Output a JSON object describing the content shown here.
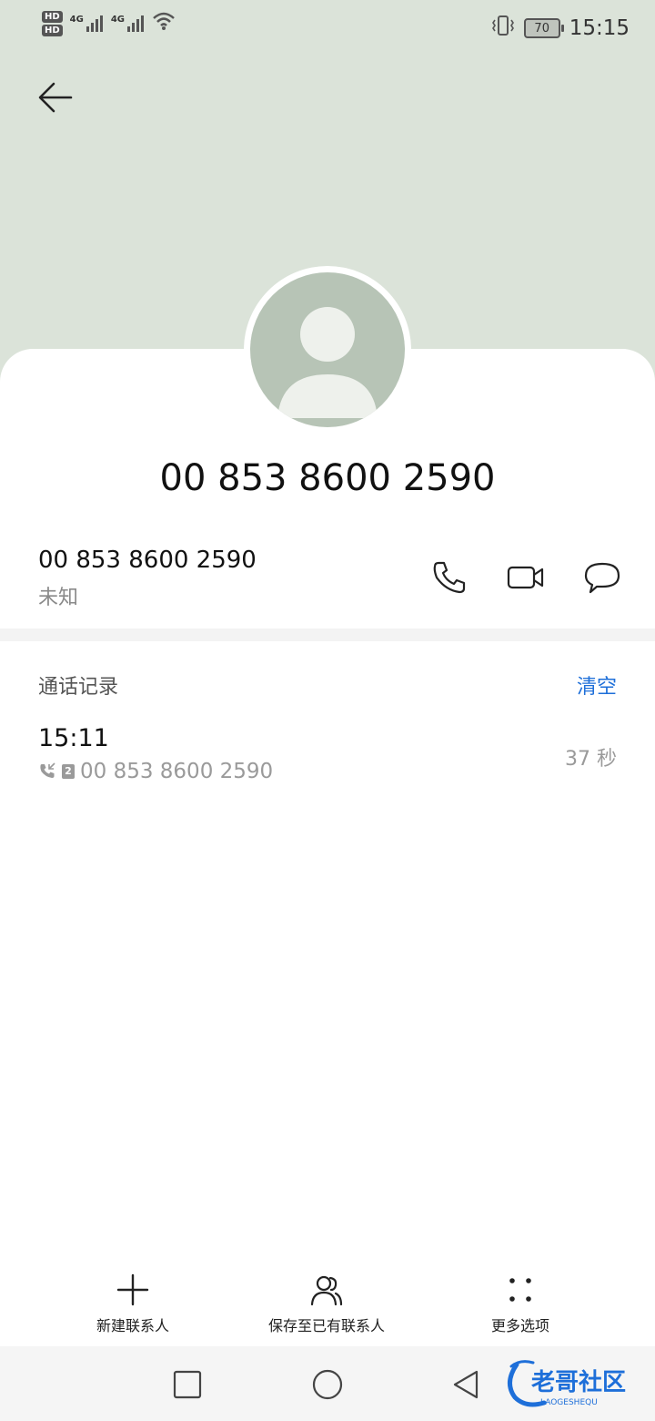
{
  "status_bar": {
    "hd1": "HD",
    "hd2": "HD",
    "net1": "4G",
    "net2": "4G",
    "battery": "70",
    "time": "15:15"
  },
  "header": {
    "back_icon": "arrow-left-icon"
  },
  "contact": {
    "title_number": "00 853 8600 2590",
    "number": "00 853 8600 2590",
    "label": "未知"
  },
  "actions": {
    "call_icon": "phone-icon",
    "video_icon": "video-call-icon",
    "message_icon": "message-bubble-icon"
  },
  "call_log": {
    "title": "通话记录",
    "clear_label": "清空",
    "entries": [
      {
        "time": "15:11",
        "sim": "2",
        "number": "00 853 8600 2590",
        "duration": "37 秒"
      }
    ]
  },
  "bottom_actions": [
    {
      "label": "新建联系人",
      "icon": "plus-icon"
    },
    {
      "label": "保存至已有联系人",
      "icon": "contacts-icon"
    },
    {
      "label": "更多选项",
      "icon": "more-dots-icon"
    }
  ],
  "watermark": {
    "text": "老哥社区",
    "subtext": "LAOGESHEQU"
  },
  "colors": {
    "header_bg": "#dbe3d9",
    "avatar_bg": "#b7c4b6",
    "accent": "#1e6fd9"
  }
}
